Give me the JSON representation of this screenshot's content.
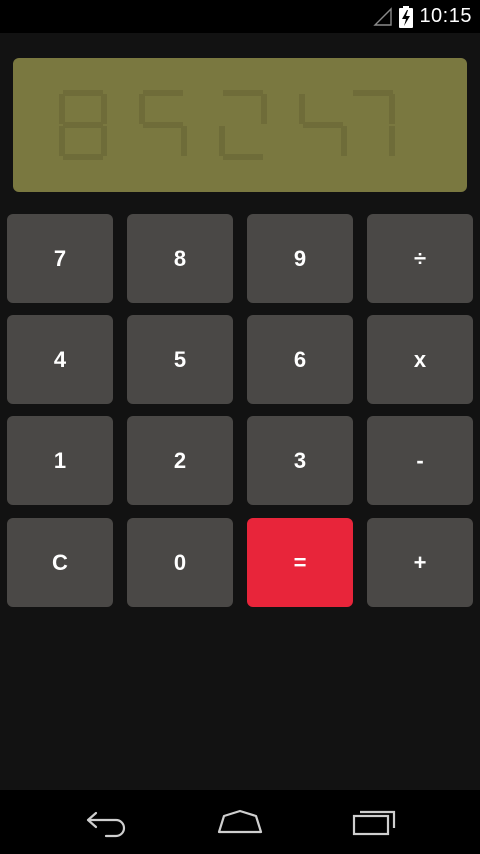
{
  "status_bar": {
    "time": "10:15",
    "signal_icon": "signal-empty-icon",
    "battery_icon": "battery-charging-icon"
  },
  "display": {
    "value": "",
    "background_color": "#7a7840"
  },
  "keypad": {
    "rows": [
      [
        "7",
        "8",
        "9",
        "÷"
      ],
      [
        "4",
        "5",
        "6",
        "x"
      ],
      [
        "1",
        "2",
        "3",
        "-"
      ],
      [
        "C",
        "0",
        "=",
        "+"
      ]
    ],
    "button_color": "#4a4846",
    "equals_color": "#e8253a"
  },
  "nav_bar": {
    "back_icon": "back-icon",
    "home_icon": "home-icon",
    "recents_icon": "recents-icon"
  }
}
